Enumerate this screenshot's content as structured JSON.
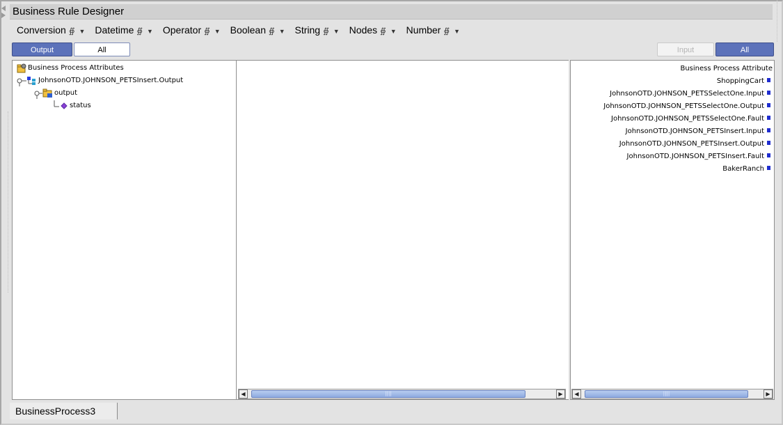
{
  "window": {
    "title": "Business Rule Designer"
  },
  "menus": [
    {
      "label": "Conversion"
    },
    {
      "label": "Datetime"
    },
    {
      "label": "Operator"
    },
    {
      "label": "Boolean"
    },
    {
      "label": "String"
    },
    {
      "label": "Nodes"
    },
    {
      "label": "Number"
    }
  ],
  "left_toolbar": {
    "output_label": "Output",
    "all_label": "All"
  },
  "right_toolbar": {
    "input_label": "Input",
    "all_label": "All"
  },
  "left_tree": {
    "root": "Business Process Attributes",
    "node1": "JohnsonOTD.JOHNSON_PETSInsert.Output",
    "node2": "output",
    "node3": "status"
  },
  "right_list": {
    "header": "Business Process Attribute",
    "items": [
      "ShoppingCart",
      "JohnsonOTD.JOHNSON_PETSSelectOne.Input",
      "JohnsonOTD.JOHNSON_PETSSelectOne.Output",
      "JohnsonOTD.JOHNSON_PETSSelectOne.Fault",
      "JohnsonOTD.JOHNSON_PETSInsert.Input",
      "JohnsonOTD.JOHNSON_PETSInsert.Output",
      "JohnsonOTD.JOHNSON_PETSInsert.Fault",
      "BakerRanch"
    ]
  },
  "bottom_tab": {
    "label": "BusinessProcess3"
  },
  "colors": {
    "accent": "#5c72ba",
    "port": "#1f2dcf",
    "chrome": "#e3e3e3"
  },
  "icons": {
    "root": "folder-gear-icon",
    "node1": "blue-tree-icon",
    "node2": "folder-icon",
    "node3": "purple-diamond-icon"
  }
}
